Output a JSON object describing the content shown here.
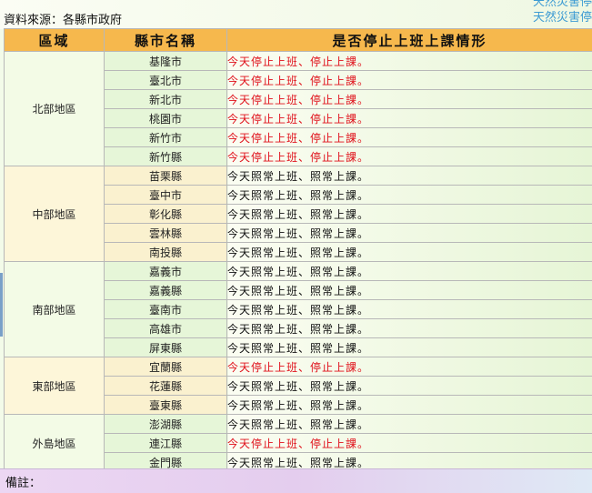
{
  "source_label": "資料來源：各縣市政府",
  "top_right_links": [
    "天然災害停",
    "天然災害停"
  ],
  "headers": {
    "region": "區域",
    "city": "縣市名稱",
    "status": "是否停止上班上課情形"
  },
  "regions": [
    {
      "name": "北部地區",
      "rows": [
        {
          "city": "基隆市",
          "status": "今天停止上班、停止上課。",
          "stopped": true
        },
        {
          "city": "臺北市",
          "status": "今天停止上班、停止上課。",
          "stopped": true
        },
        {
          "city": "新北市",
          "status": "今天停止上班、停止上課。",
          "stopped": true
        },
        {
          "city": "桃園市",
          "status": "今天停止上班、停止上課。",
          "stopped": true
        },
        {
          "city": "新竹市",
          "status": "今天停止上班、停止上課。",
          "stopped": true
        },
        {
          "city": "新竹縣",
          "status": "今天停止上班、停止上課。",
          "stopped": true
        }
      ]
    },
    {
      "name": "中部地區",
      "rows": [
        {
          "city": "苗栗縣",
          "status": "今天照常上班、照常上課。",
          "stopped": false
        },
        {
          "city": "臺中市",
          "status": "今天照常上班、照常上課。",
          "stopped": false
        },
        {
          "city": "彰化縣",
          "status": "今天照常上班、照常上課。",
          "stopped": false
        },
        {
          "city": "雲林縣",
          "status": "今天照常上班、照常上課。",
          "stopped": false
        },
        {
          "city": "南投縣",
          "status": "今天照常上班、照常上課。",
          "stopped": false
        }
      ]
    },
    {
      "name": "南部地區",
      "rows": [
        {
          "city": "嘉義市",
          "status": "今天照常上班、照常上課。",
          "stopped": false
        },
        {
          "city": "嘉義縣",
          "status": "今天照常上班、照常上課。",
          "stopped": false
        },
        {
          "city": "臺南市",
          "status": "今天照常上班、照常上課。",
          "stopped": false
        },
        {
          "city": "高雄市",
          "status": "今天照常上班、照常上課。",
          "stopped": false
        },
        {
          "city": "屏東縣",
          "status": "今天照常上班、照常上課。",
          "stopped": false
        }
      ]
    },
    {
      "name": "東部地區",
      "rows": [
        {
          "city": "宜蘭縣",
          "status": "今天停止上班、停止上課。",
          "stopped": true
        },
        {
          "city": "花蓮縣",
          "status": "今天照常上班、照常上課。",
          "stopped": false
        },
        {
          "city": "臺東縣",
          "status": "今天照常上班、照常上課。",
          "stopped": false
        }
      ]
    },
    {
      "name": "外島地區",
      "rows": [
        {
          "city": "澎湖縣",
          "status": "今天照常上班、照常上課。",
          "stopped": false
        },
        {
          "city": "連江縣",
          "status": "今天停止上班、停止上課。",
          "stopped": true
        },
        {
          "city": "金門縣",
          "status": "今天照常上班、照常上課。",
          "stopped": false
        }
      ]
    }
  ],
  "footer_label": "備註：",
  "colors": {
    "header_bg": "#f6b84d",
    "stop_text": "#e0101a",
    "link_blue": "#3d9bd3"
  }
}
